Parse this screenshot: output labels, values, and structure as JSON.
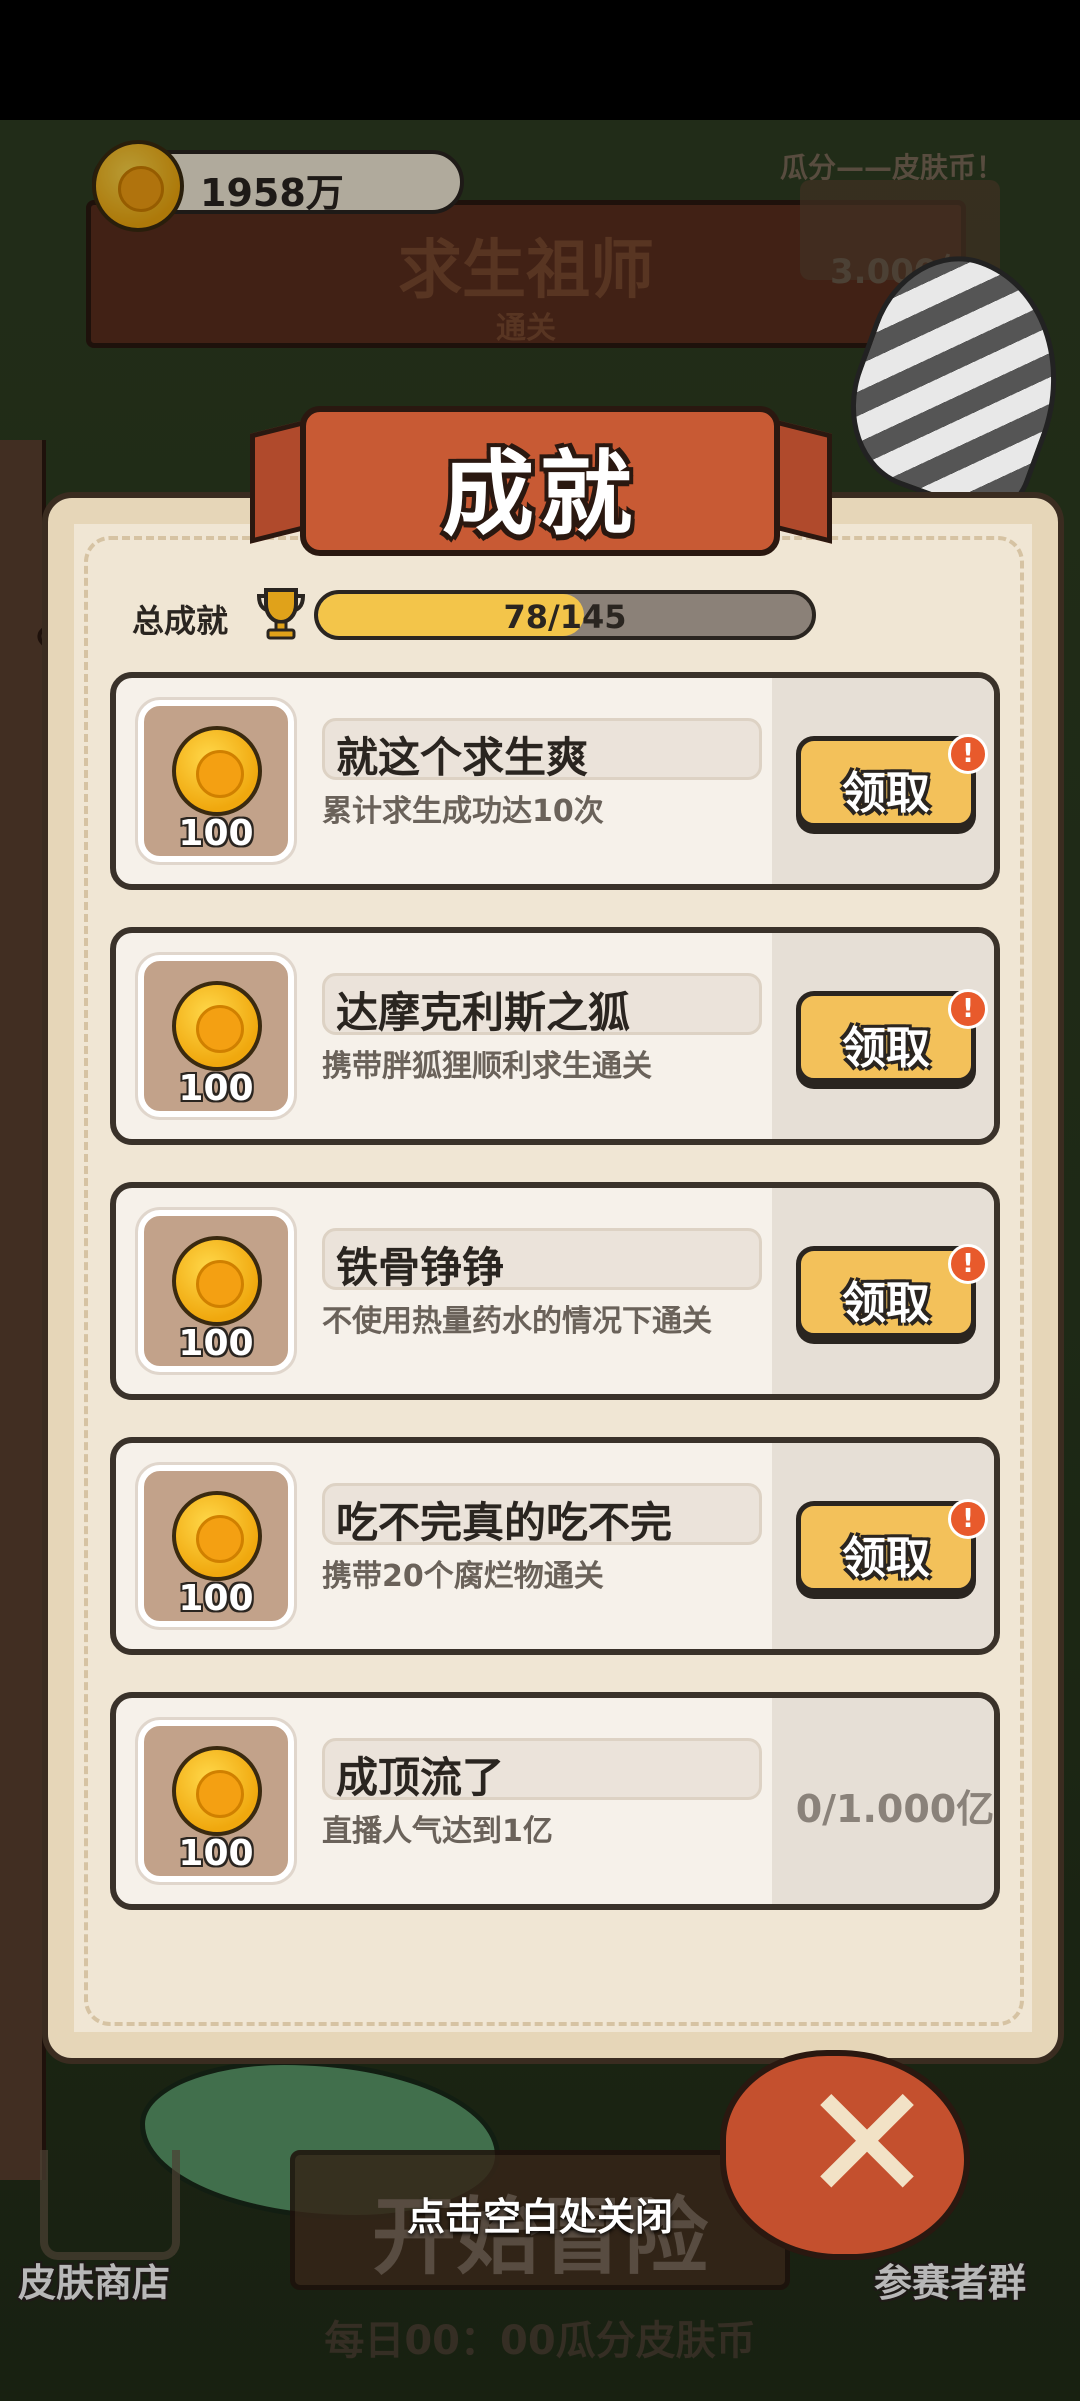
{
  "header": {
    "coins": "1958万",
    "sign_title": "求生祖师",
    "sign_subtitle": "通关",
    "share_label": "瓜分——皮肤币！",
    "share_amount": "3.000亿"
  },
  "dialog": {
    "title": "成就",
    "total_label": "总成就",
    "total_progress": "78/145",
    "total_fraction": 0.538
  },
  "achievements": [
    {
      "reward": "100",
      "name": "就这个求生爽",
      "desc": "累计求生成功达10次",
      "action": "领取",
      "badge": "!"
    },
    {
      "reward": "100",
      "name": "达摩克利斯之狐",
      "desc": "携带胖狐狸顺利求生通关",
      "action": "领取",
      "badge": "!"
    },
    {
      "reward": "100",
      "name": "铁骨铮铮",
      "desc": "不使用热量药水的情况下通关",
      "action": "领取",
      "badge": "!"
    },
    {
      "reward": "100",
      "name": "吃不完真的吃不完",
      "desc": "携带20个腐烂物通关",
      "action": "领取",
      "badge": "!"
    },
    {
      "reward": "100",
      "name": "成顶流了",
      "desc": "直播人气达到1亿",
      "progress": "0/1.000亿"
    }
  ],
  "bottom": {
    "start_label": "开始冒险",
    "tap_close": "点击空白处关闭",
    "shop_label": "皮肤商店",
    "group_label": "参赛者群",
    "daily_text": "每日00：00瓜分皮肤币",
    "close_symbol": "✕"
  }
}
